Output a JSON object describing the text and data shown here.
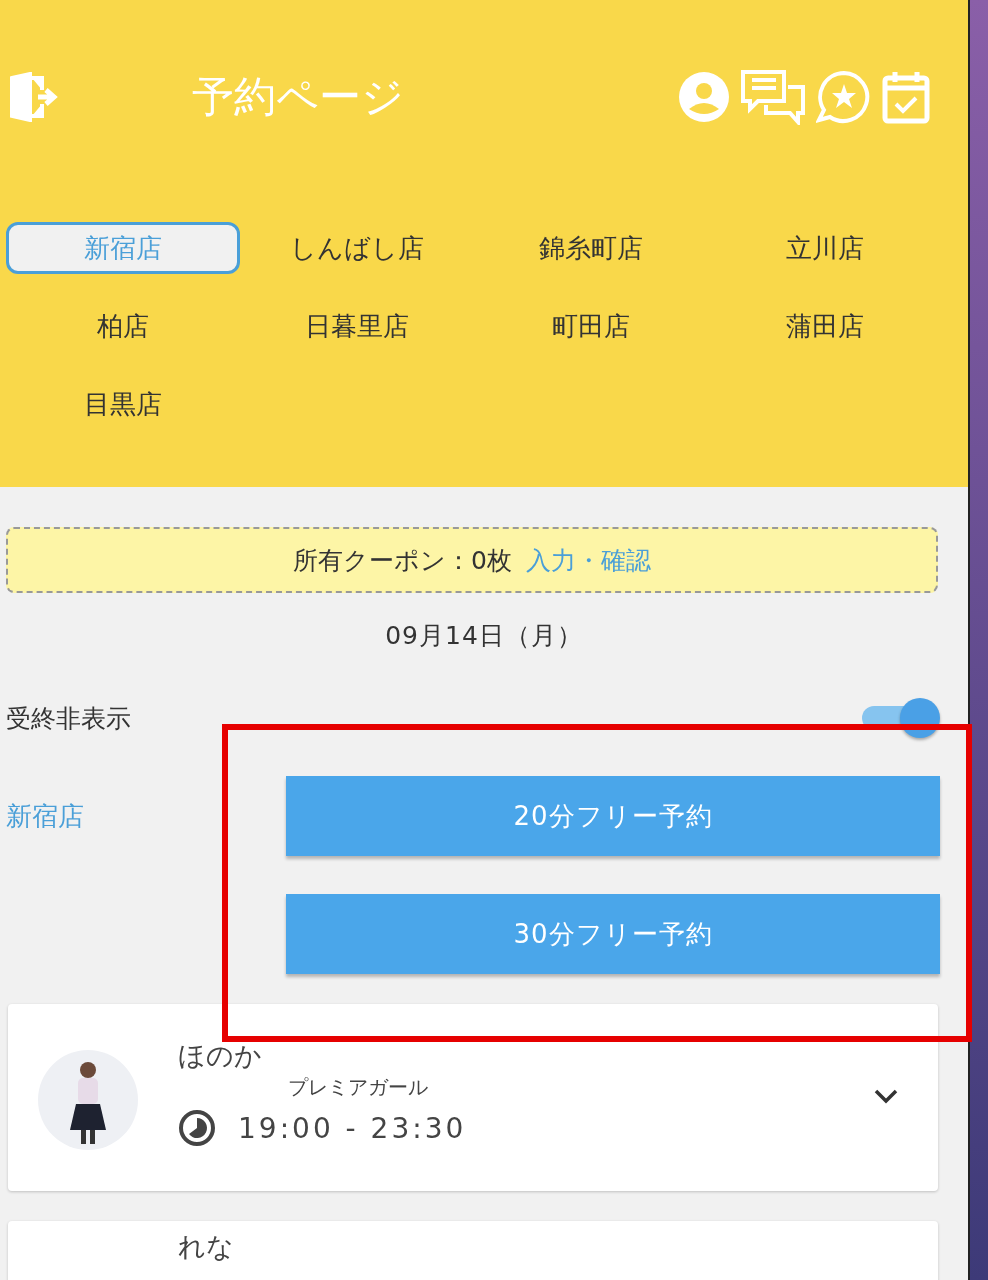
{
  "header": {
    "title": "予約ページ"
  },
  "stores": [
    {
      "label": "新宿店",
      "selected": true
    },
    {
      "label": "しんばし店",
      "selected": false
    },
    {
      "label": "錦糸町店",
      "selected": false
    },
    {
      "label": "立川店",
      "selected": false
    },
    {
      "label": "柏店",
      "selected": false
    },
    {
      "label": "日暮里店",
      "selected": false
    },
    {
      "label": "町田店",
      "selected": false
    },
    {
      "label": "蒲田店",
      "selected": false
    },
    {
      "label": "目黒店",
      "selected": false
    }
  ],
  "coupon": {
    "text": "所有クーポン：0枚",
    "link": "入力・確認"
  },
  "date": "09月14日（月）",
  "hide_closed": {
    "label": "受終非表示",
    "on": true
  },
  "booking": {
    "store": "新宿店",
    "buttons": [
      "20分フリー予約",
      "30分フリー予約"
    ]
  },
  "staff": [
    {
      "name": "ほのか",
      "rank": "プレミアガール",
      "hours": "19:00 - 23:30"
    },
    {
      "name": "れな"
    }
  ]
}
